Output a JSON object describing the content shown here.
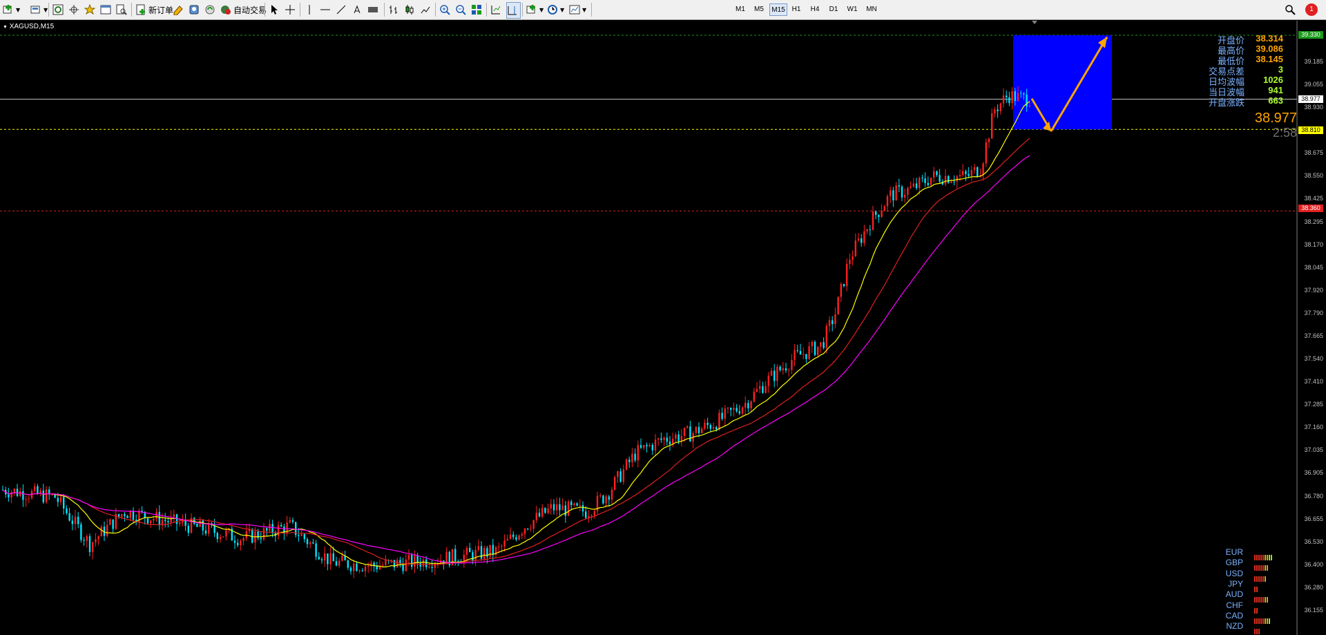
{
  "toolbar": {
    "new_order_label": "新订单",
    "auto_trade_label": "自动交易",
    "timeframes": [
      "M1",
      "M5",
      "M15",
      "H1",
      "H4",
      "D1",
      "W1",
      "MN"
    ],
    "active_timeframe": "M15",
    "notification_count": "1"
  },
  "chart": {
    "symbol": "XAGUSD,M15",
    "current_price": "38.977",
    "countdown": "2:58",
    "price_labels": [
      "39.185",
      "39.055",
      "38.930",
      "38.800",
      "38.675",
      "38.550",
      "38.425",
      "38.295",
      "38.170",
      "38.045",
      "37.920",
      "37.790",
      "37.665",
      "37.540",
      "37.410",
      "37.285",
      "37.160",
      "37.035",
      "36.905",
      "36.780",
      "36.655",
      "36.530",
      "36.400",
      "36.280",
      "36.155"
    ],
    "line_tags": {
      "top": "39.330",
      "current": "38.977",
      "yellow": "38.810",
      "red": "38.360"
    },
    "colors": {
      "up": "#ff2020",
      "down": "#00e5ff",
      "ma_fast": "#ffff00",
      "ma_mid": "#e02020",
      "ma_slow": "#ff00ff",
      "box": "#0000ff",
      "arrow": "#ffa500"
    }
  },
  "info_panel": [
    {
      "label": "开盘价",
      "value": "38.314"
    },
    {
      "label": "最高价",
      "value": "39.086"
    },
    {
      "label": "最低价",
      "value": "38.145"
    },
    {
      "label": "交易点差",
      "value": "3"
    },
    {
      "label": "日均波幅",
      "value": "1026"
    },
    {
      "label": "当日波幅",
      "value": "941"
    },
    {
      "label": "开盘涨跌",
      "value": "663"
    }
  ],
  "currency_strength": [
    {
      "name": "EUR",
      "level": 9
    },
    {
      "name": "GBP",
      "level": 7
    },
    {
      "name": "USD",
      "level": 6
    },
    {
      "name": "JPY",
      "level": 2
    },
    {
      "name": "AUD",
      "level": 7
    },
    {
      "name": "CHF",
      "level": 2
    },
    {
      "name": "CAD",
      "level": 8
    },
    {
      "name": "NZD",
      "level": 3
    }
  ]
}
